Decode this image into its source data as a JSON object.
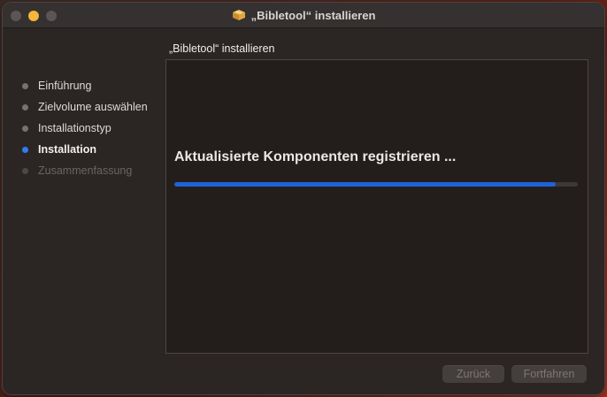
{
  "window": {
    "title": "„Bibletool“ installieren"
  },
  "sidebar": {
    "steps": [
      {
        "label": "Einführung",
        "state": "done"
      },
      {
        "label": "Zielvolume auswählen",
        "state": "done"
      },
      {
        "label": "Installationstyp",
        "state": "done"
      },
      {
        "label": "Installation",
        "state": "active"
      },
      {
        "label": "Zusammenfassung",
        "state": "disabled"
      }
    ]
  },
  "main": {
    "heading": "„Bibletool“ installieren",
    "status": "Aktualisierte Komponenten registrieren ...",
    "progress": 0.945
  },
  "buttons": {
    "back_label": "Zurück",
    "continue_label": "Fortfahren"
  },
  "colors": {
    "accent": "#2f7cf6",
    "progress": "#1f62d9"
  },
  "icons": {
    "title_icon": "package-icon"
  }
}
